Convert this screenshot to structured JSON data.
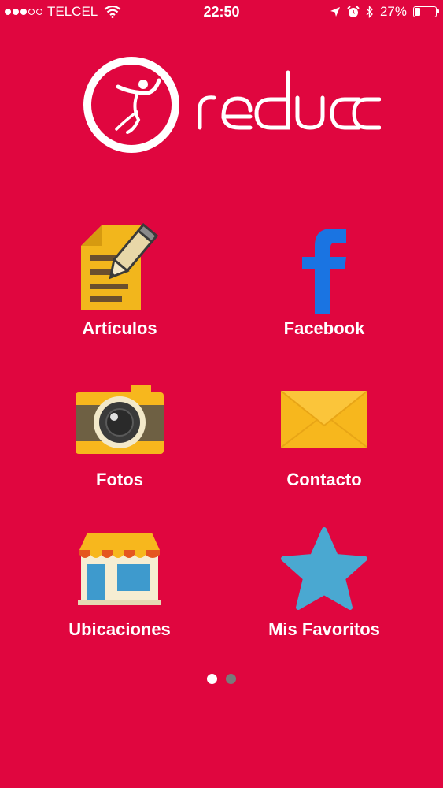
{
  "status_bar": {
    "carrier": "TELCEL",
    "time": "22:50",
    "battery_percent": "27%",
    "battery_level": 0.27,
    "signal_bars_filled": 3,
    "signal_bars_total": 5
  },
  "brand": {
    "logo_text": "reduce",
    "background_color": "#E0063F"
  },
  "menu": {
    "items": [
      {
        "label": "Artículos",
        "icon": "document-pencil-icon"
      },
      {
        "label": "Facebook",
        "icon": "facebook-icon"
      },
      {
        "label": "Fotos",
        "icon": "camera-icon"
      },
      {
        "label": "Contacto",
        "icon": "envelope-icon"
      },
      {
        "label": "Ubicaciones",
        "icon": "store-icon"
      },
      {
        "label": "Mis Favoritos",
        "icon": "star-icon"
      }
    ]
  },
  "pager": {
    "pages": 2,
    "current": 1
  }
}
